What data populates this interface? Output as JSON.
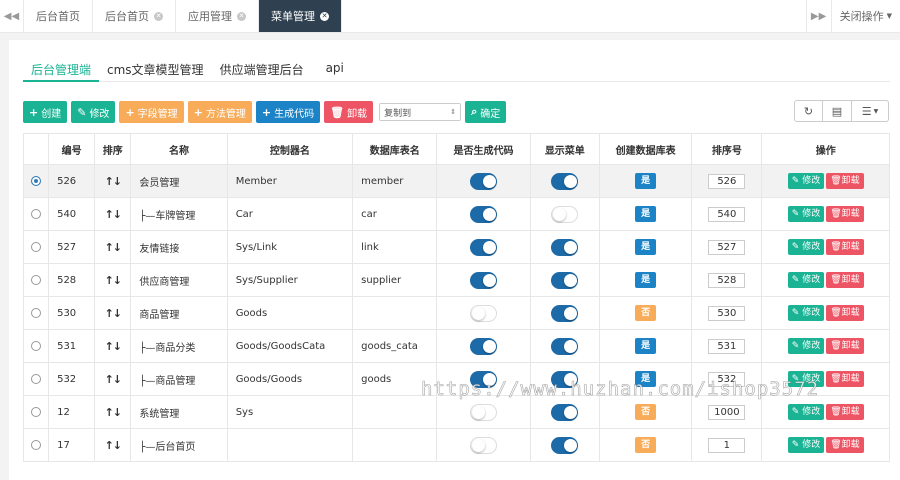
{
  "topbar": {
    "left_arrow": "◀◀",
    "tabs": [
      {
        "label": "后台首页",
        "closable": false,
        "active": false
      },
      {
        "label": "后台首页",
        "closable": true,
        "active": false
      },
      {
        "label": "应用管理",
        "closable": true,
        "active": false
      },
      {
        "label": "菜单管理",
        "closable": true,
        "active": true
      }
    ],
    "right_arrow": "▶▶",
    "close_ops_label": "关闭操作"
  },
  "subtabs": [
    "后台管理端",
    "cms文章模型管理",
    "供应端管理后台",
    "api"
  ],
  "toolbar": {
    "create": "创建",
    "edit": "修改",
    "field_manage": "字段管理",
    "method_manage": "方法管理",
    "generate_code": "生成代码",
    "uninstall": "卸载",
    "copy_to_placeholder": "复制到",
    "confirm": "确定"
  },
  "table": {
    "headers": [
      "",
      "编号",
      "排序",
      "名称",
      "控制器名",
      "数据库表名",
      "是否生成代码",
      "显示菜单",
      "创建数据库表",
      "排序号",
      "操作"
    ],
    "sort_icon": "↑↓",
    "edit_label": "修改",
    "uninstall_label": "卸载",
    "yes_label": "是",
    "no_label": "否",
    "rows": [
      {
        "selected": true,
        "id": "526",
        "name": "会员管理",
        "controller": "Member",
        "table": "member",
        "gen_code": true,
        "show_menu": true,
        "create_table": true,
        "sort_no": "526"
      },
      {
        "selected": false,
        "id": "540",
        "name": "├—车牌管理",
        "controller": "Car",
        "table": "car",
        "gen_code": true,
        "show_menu": false,
        "create_table": true,
        "sort_no": "540"
      },
      {
        "selected": false,
        "id": "527",
        "name": "友情链接",
        "controller": "Sys/Link",
        "table": "link",
        "gen_code": true,
        "show_menu": true,
        "create_table": true,
        "sort_no": "527"
      },
      {
        "selected": false,
        "id": "528",
        "name": "供应商管理",
        "controller": "Sys/Supplier",
        "table": "supplier",
        "gen_code": true,
        "show_menu": true,
        "create_table": true,
        "sort_no": "528"
      },
      {
        "selected": false,
        "id": "530",
        "name": "商品管理",
        "controller": "Goods",
        "table": "",
        "gen_code": false,
        "show_menu": true,
        "create_table": false,
        "sort_no": "530"
      },
      {
        "selected": false,
        "id": "531",
        "name": "├—商品分类",
        "controller": "Goods/GoodsCata",
        "table": "goods_cata",
        "gen_code": true,
        "show_menu": true,
        "create_table": true,
        "sort_no": "531"
      },
      {
        "selected": false,
        "id": "532",
        "name": "├—商品管理",
        "controller": "Goods/Goods",
        "table": "goods",
        "gen_code": true,
        "show_menu": true,
        "create_table": true,
        "sort_no": "532"
      },
      {
        "selected": false,
        "id": "12",
        "name": "系统管理",
        "controller": "Sys",
        "table": "",
        "gen_code": false,
        "show_menu": true,
        "create_table": false,
        "sort_no": "1000"
      },
      {
        "selected": false,
        "id": "17",
        "name": "├—后台首页",
        "controller": "",
        "table": "",
        "gen_code": false,
        "show_menu": true,
        "create_table": false,
        "sort_no": "1"
      }
    ]
  },
  "watermark": "https://www.huzhan.com/ishop3572",
  "colors": {
    "primary": "#1ab394",
    "warning": "#f8ac59",
    "info": "#1c84c6",
    "danger": "#ed5565",
    "dark": "#2f4050"
  }
}
